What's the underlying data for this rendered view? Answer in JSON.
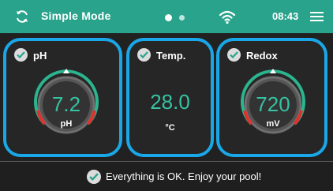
{
  "topbar": {
    "mode_label": "Simple Mode",
    "time": "08:43",
    "mode_icon": "sync-arrows-icon",
    "wifi_icon": "wifi-icon",
    "menu_icon": "hamburger-menu-icon",
    "page_indicator": {
      "pages": 2,
      "active": 1
    }
  },
  "cards": {
    "ph": {
      "title": "pH",
      "value": "7.2",
      "unit": "pH",
      "status_icon": "check-circle-icon",
      "marker_level": 0.5
    },
    "temp": {
      "title": "Temp.",
      "value": "28.0",
      "unit": "°C",
      "status_icon": "check-circle-icon"
    },
    "redox": {
      "title": "Redox",
      "value": "720",
      "unit": "mV",
      "status_icon": "check-circle-icon",
      "marker_level": 0.5
    }
  },
  "footer": {
    "message": "Everything is OK. Enjoy your pool!",
    "status_icon": "check-circle-icon"
  },
  "colors": {
    "header_bg": "#2aa38c",
    "card_border": "#1aa7e8",
    "value_text": "#36c2a3",
    "gauge_green": "#2bb58f",
    "gauge_red": "#e0312c"
  }
}
